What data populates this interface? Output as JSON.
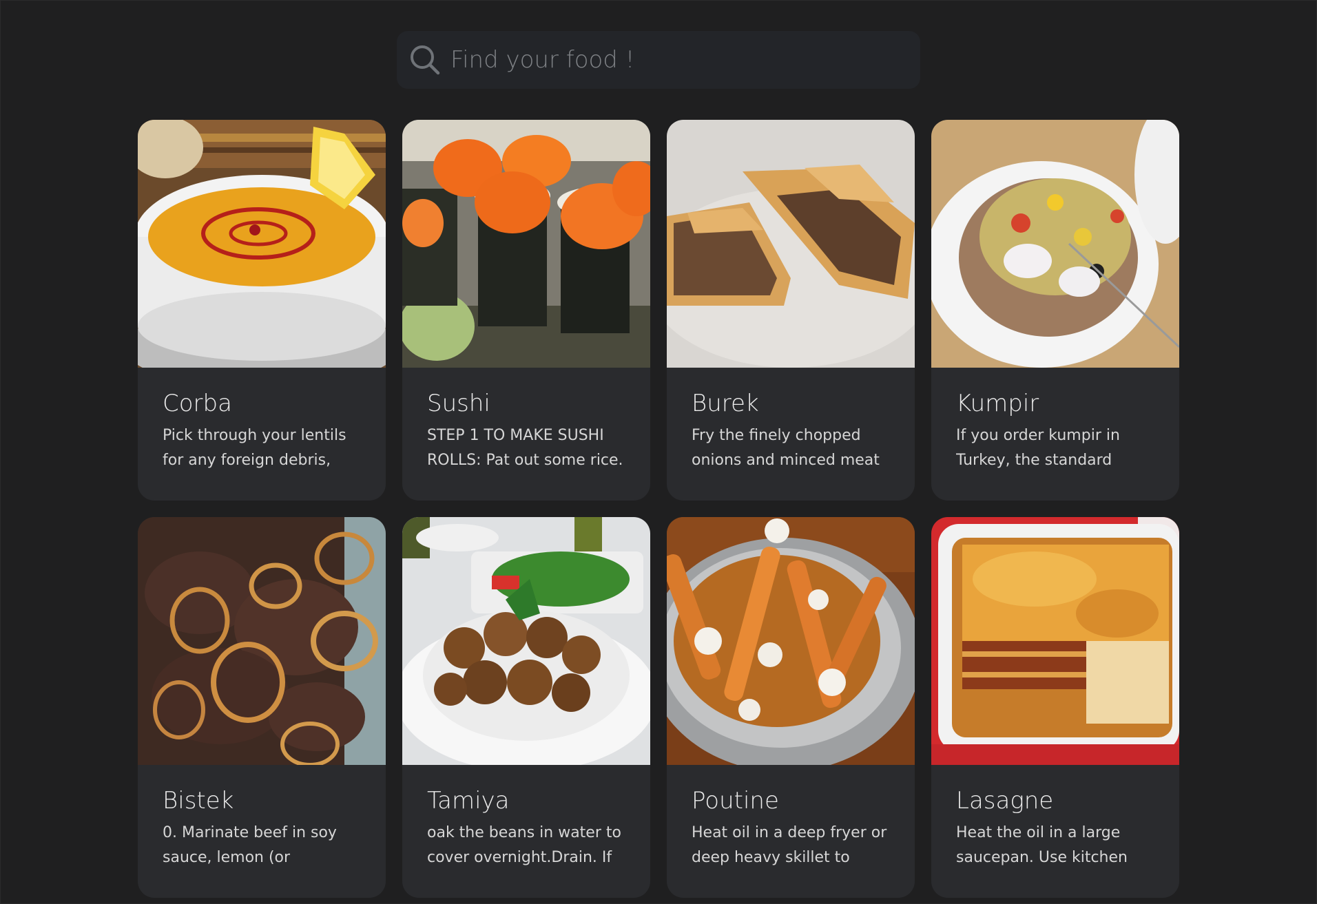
{
  "search": {
    "placeholder": "Find your food !"
  },
  "foods": [
    {
      "name": "Corba",
      "description": "Pick through your lentils for any foreign debris,",
      "image": "soup-bowl-image"
    },
    {
      "name": "Sushi",
      "description": "STEP 1 TO MAKE SUSHI ROLLS: Pat out some rice.",
      "image": "sushi-rolls-image"
    },
    {
      "name": "Burek",
      "description": "Fry the finely chopped onions and minced meat",
      "image": "burek-pastry-image"
    },
    {
      "name": "Kumpir",
      "description": "If you order kumpir in Turkey, the standard",
      "image": "baked-potato-image"
    },
    {
      "name": "Bistek",
      "description": "0. Marinate beef in soy sauce, lemon (or",
      "image": "beef-onions-image"
    },
    {
      "name": "Tamiya",
      "description": "oak the beans in water to cover overnight.Drain. If",
      "image": "falafel-plate-image"
    },
    {
      "name": "Poutine",
      "description": "Heat oil in a deep fryer or deep heavy skillet to",
      "image": "poutine-fries-image"
    },
    {
      "name": "Lasagne",
      "description": "Heat the oil in a large saucepan. Use kitchen",
      "image": "lasagne-dish-image"
    }
  ]
}
